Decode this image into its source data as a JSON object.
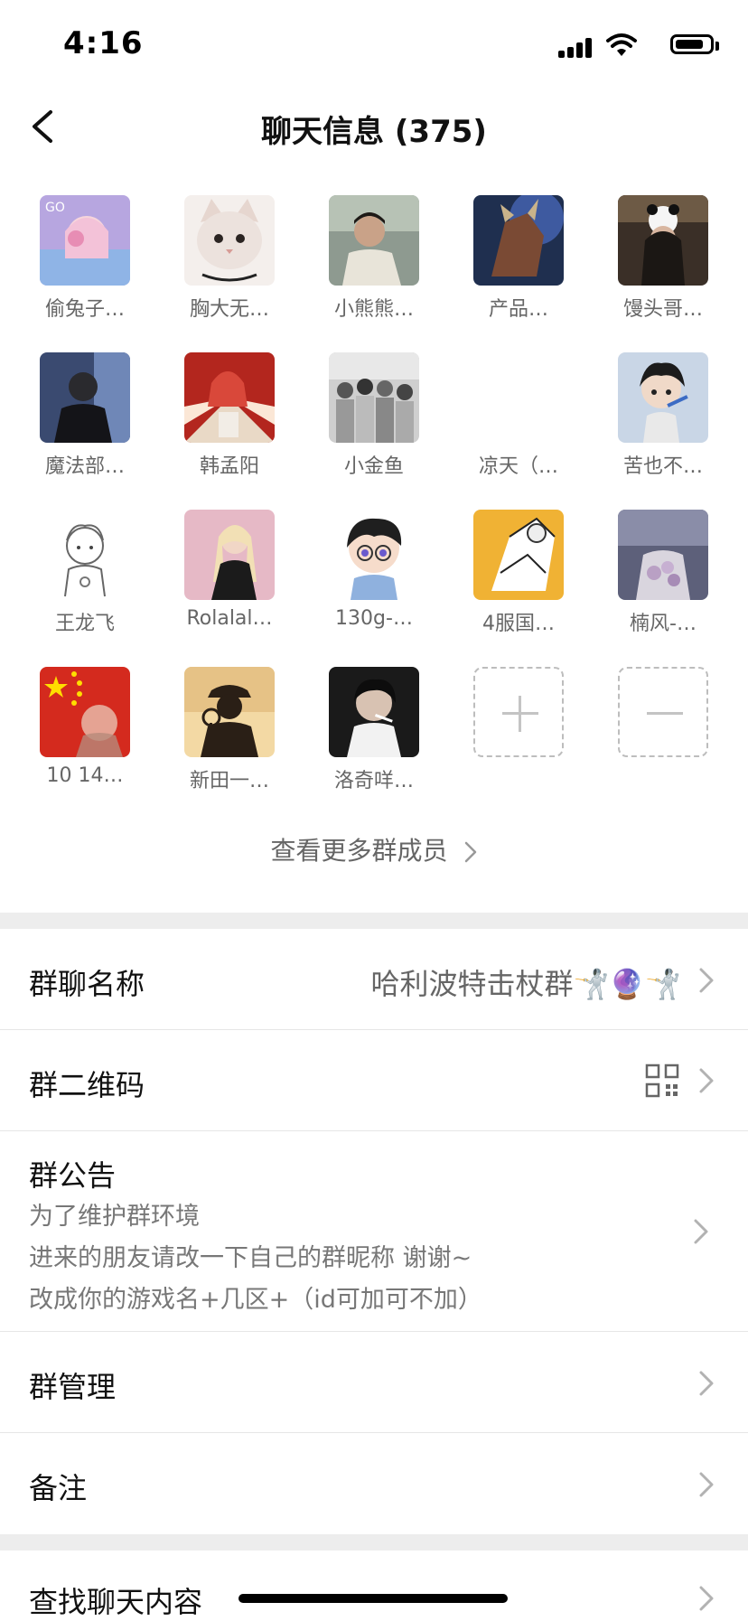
{
  "status_bar": {
    "time": "4:16"
  },
  "nav": {
    "title": "聊天信息 (375)"
  },
  "members": [
    {
      "name": "偷兔子…",
      "icon": "anime-girl-headphones-avatar"
    },
    {
      "name": "胸大无…",
      "icon": "cat-avatar"
    },
    {
      "name": "小熊熊…",
      "icon": "man-photo-avatar"
    },
    {
      "name": "产品…",
      "icon": "game-character-avatar"
    },
    {
      "name": "馒头哥…",
      "icon": "girl-panda-hat-avatar"
    },
    {
      "name": "魔法部…",
      "icon": "man-dark-avatar"
    },
    {
      "name": "韩孟阳",
      "icon": "red-anime-avatar"
    },
    {
      "name": "小金鱼",
      "icon": "bw-group-photo-avatar"
    },
    {
      "name": "凉天（…",
      "icon": "blank-avatar"
    },
    {
      "name": "苦也不…",
      "icon": "cartoon-boy-avatar"
    },
    {
      "name": "王龙飞",
      "icon": "sketch-boy-avatar"
    },
    {
      "name": "Rolalal…",
      "icon": "blonde-girl-avatar"
    },
    {
      "name": "130g-…",
      "icon": "chibi-glasses-avatar"
    },
    {
      "name": "4服国…",
      "icon": "manga-yellow-avatar"
    },
    {
      "name": "楠风-…",
      "icon": "flowers-photo-avatar"
    },
    {
      "name": "10 14…",
      "icon": "flag-avatar"
    },
    {
      "name": "新田一…",
      "icon": "detective-silhouette-avatar"
    },
    {
      "name": "洛奇咩…",
      "icon": "smoking-man-avatar"
    }
  ],
  "more_members": "查看更多群成员",
  "rows": {
    "group_name": {
      "label": "群聊名称",
      "value": "哈利波特击杖群🤺🔮🤺"
    },
    "qr_code": {
      "label": "群二维码"
    },
    "announcement": {
      "label": "群公告",
      "lines": [
        "为了维护群环境",
        "进来的朋友请改一下自己的群昵称 谢谢~",
        "改成你的游戏名+几区+（id可加可不加）"
      ]
    },
    "management": {
      "label": "群管理"
    },
    "remark": {
      "label": "备注"
    },
    "search": {
      "label": "查找聊天内容"
    }
  },
  "colors": {
    "background": "#ffffff",
    "divider": "#ededed",
    "secondary_text": "#666666"
  }
}
